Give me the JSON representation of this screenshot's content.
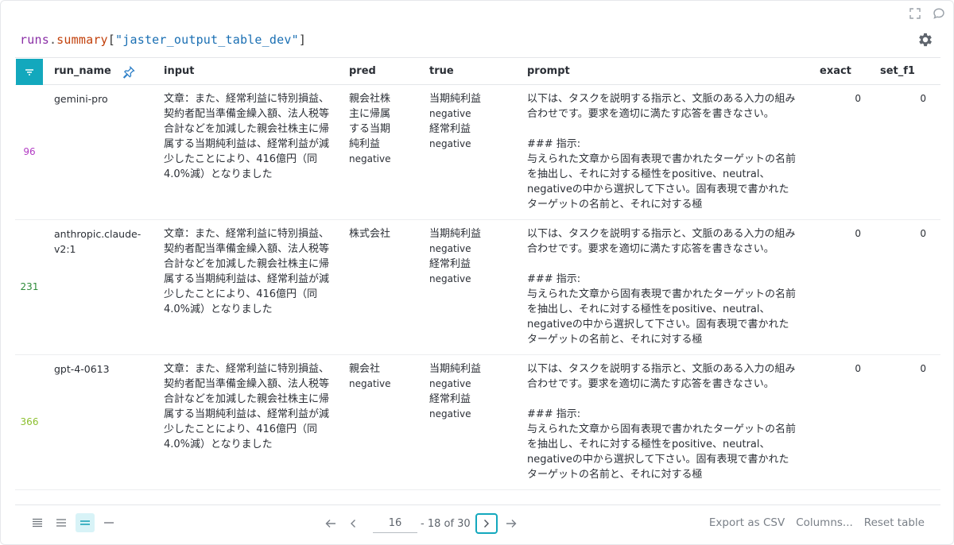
{
  "expression": {
    "runs": "runs",
    "dot": ".",
    "summary": "summary",
    "open": "[",
    "key": "\"jaster_output_table_dev\"",
    "close": "]"
  },
  "columns": {
    "run_name": "run_name",
    "input": "input",
    "pred": "pred",
    "true": "true",
    "prompt": "prompt",
    "exact": "exact",
    "set_f1": "set_f1"
  },
  "rows": [
    {
      "index": "96",
      "index_color": "#b23cc4",
      "run_name": "gemini-pro",
      "input": "文章：また、経常利益に特別損益、契約者配当準備金繰入額、法人税等合計などを加減した親会社株主に帰属する当期純利益は、経常利益が減少したことにより、416億円（同4.0%減）となりました",
      "pred_lines": [
        "親会社株",
        "主に帰属",
        "する当期",
        "純利益"
      ],
      "pred_label": "negative",
      "true_a": "当期純利益",
      "true_a_label": "negative",
      "true_b": "経常利益",
      "true_b_label": "negative",
      "prompt_intro": "以下は、タスクを説明する指示と、文脈のある入力の組み合わせです。要求を適切に満たす応答を書きなさい。",
      "prompt_heading": "### 指示:",
      "prompt_body": "与えられた文章から固有表現で書かれたターゲットの名前を抽出し、それに対する極性をpositive、neutral、negativeの中から選択して下さい。固有表現で書かれたターゲットの名前と、それに対する極",
      "exact": "0",
      "set_f1": "0"
    },
    {
      "index": "231",
      "index_color": "#2e8b3a",
      "run_name": "anthropic.claude-v2:1",
      "input": "文章：また、経常利益に特別損益、契約者配当準備金繰入額、法人税等合計などを加減した親会社株主に帰属する当期純利益は、経常利益が減少したことにより、416億円（同4.0%減）となりました",
      "pred_lines": [
        "株式会社"
      ],
      "pred_label": "",
      "true_a": "当期純利益",
      "true_a_label": "negative",
      "true_b": "経常利益",
      "true_b_label": "negative",
      "prompt_intro": "以下は、タスクを説明する指示と、文脈のある入力の組み合わせです。要求を適切に満たす応答を書きなさい。",
      "prompt_heading": "### 指示:",
      "prompt_body": "与えられた文章から固有表現で書かれたターゲットの名前を抽出し、それに対する極性をpositive、neutral、negativeの中から選択して下さい。固有表現で書かれたターゲットの名前と、それに対する極",
      "exact": "0",
      "set_f1": "0"
    },
    {
      "index": "366",
      "index_color": "#8cbf2f",
      "run_name": "gpt-4-0613",
      "input": "文章：また、経常利益に特別損益、契約者配当準備金繰入額、法人税等合計などを加減した親会社株主に帰属する当期純利益は、経常利益が減少したことにより、416億円（同4.0%減）となりました",
      "pred_lines": [
        "親会社"
      ],
      "pred_label": "negative",
      "true_a": "当期純利益",
      "true_a_label": "negative",
      "true_b": "経常利益",
      "true_b_label": "negative",
      "prompt_intro": "以下は、タスクを説明する指示と、文脈のある入力の組み合わせです。要求を適切に満たす応答を書きなさい。",
      "prompt_heading": "### 指示:",
      "prompt_body": "与えられた文章から固有表現で書かれたターゲットの名前を抽出し、それに対する極性をpositive、neutral、negativeの中から選択して下さい。固有表現で書かれたターゲットの名前と、それに対する極",
      "exact": "0",
      "set_f1": "0"
    }
  ],
  "pagination": {
    "page_value": "16",
    "range_text": "- 18 of 30"
  },
  "actions": {
    "export_csv": "Export as CSV",
    "columns": "Columns...",
    "reset": "Reset table"
  },
  "icons": {
    "fullscreen": "fullscreen-icon",
    "comment": "comment-icon",
    "settings": "gear-icon",
    "filter": "filter-icon",
    "pin": "pin-icon"
  },
  "colors": {
    "accent": "#13a8bd",
    "runs_token": "#8a2fa6",
    "summary_token": "#c2410c",
    "key_token": "#1a6fb3"
  }
}
